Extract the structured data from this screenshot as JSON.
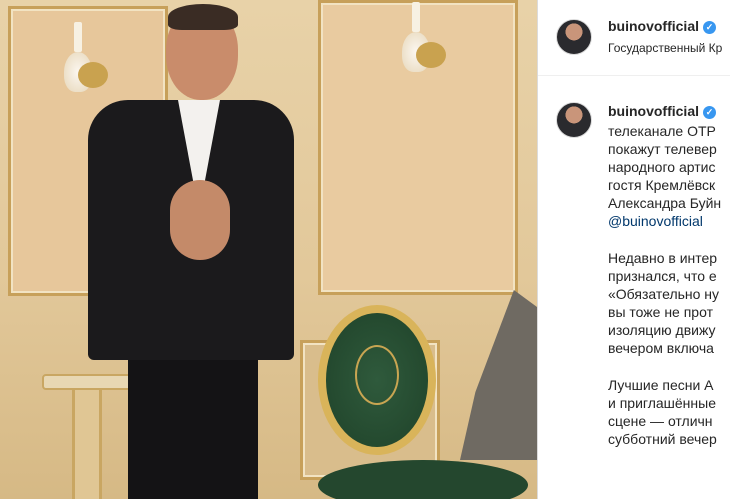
{
  "header": {
    "username": "buinovofficial",
    "location": "Государственный Кр"
  },
  "post": {
    "username": "buinovofficial",
    "caption_lines_1": [
      "телеканале ОТР",
      "покажут телевер",
      "народного артис",
      "гостя Кремлёвск",
      "Александра Буйн"
    ],
    "mention": "@buinovofficial",
    "caption_lines_2": [
      "Недавно в интер",
      "признался, что е",
      "«Обязательно ну",
      "вы тоже не прот",
      "изоляцию движу",
      "вечером включа"
    ],
    "caption_lines_3": [
      "Лучшие песни А",
      "и приглашённые",
      "сцене — отличн",
      "субботний вечер"
    ]
  },
  "icons": {
    "verified": "verified-badge-icon",
    "verified_glyph": "✓",
    "verified_color": "#3897f0"
  }
}
